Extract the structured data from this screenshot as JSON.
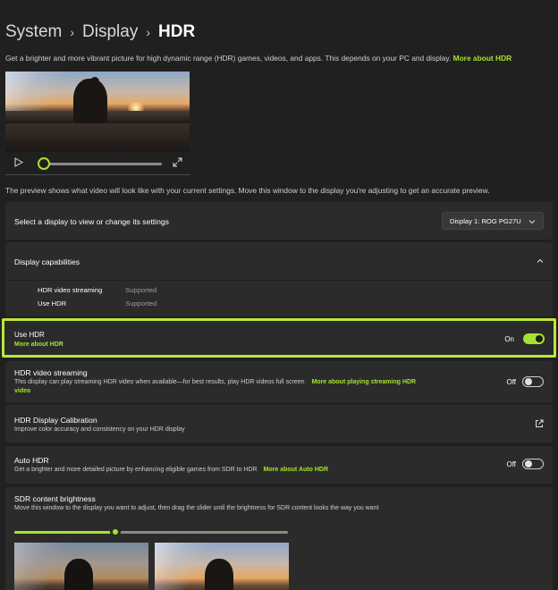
{
  "breadcrumb": {
    "items": [
      "System",
      "Display",
      "HDR"
    ],
    "separator": "›"
  },
  "intro": {
    "text": "Get a brighter and more vibrant picture for high dynamic range (HDR) games, videos, and apps. This depends on your PC and display.",
    "link": "More about HDR"
  },
  "video_preview": {
    "progress": 0.0
  },
  "preview_note": "The preview shows what video will look like with your current settings. Move this window to the display you're adjusting to get an accurate preview.",
  "display_select": {
    "label": "Select a display to view or change its settings",
    "value": "Display 1: ROG PG27U"
  },
  "capabilities": {
    "title": "Display capabilities",
    "rows": [
      {
        "name": "HDR video streaming",
        "value": "Supported"
      },
      {
        "name": "Use HDR",
        "value": "Supported"
      }
    ]
  },
  "use_hdr": {
    "title": "Use HDR",
    "link": "More about HDR",
    "state_label": "On",
    "on": true
  },
  "hdr_streaming": {
    "title": "HDR video streaming",
    "desc": "This display can play streaming HDR video when available—for best results, play HDR videos full screen",
    "link_line1": "More about playing streaming HDR",
    "link_line2": "video",
    "state_label": "Off",
    "on": false
  },
  "calibration": {
    "title": "HDR Display Calibration",
    "desc": "Improve color accuracy and consistency on your HDR display"
  },
  "auto_hdr": {
    "title": "Auto HDR",
    "desc": "Get a brighter and more detailed picture by enhancing eligible games from SDR to HDR",
    "link": "More about Auto HDR",
    "state_label": "Off",
    "on": false
  },
  "sdr_brightness": {
    "title": "SDR content brightness",
    "desc": "Move this window to the display you want to adjust, then drag the slider until the brightness for SDR content looks the way you want",
    "level": 0.37
  },
  "colors": {
    "accent": "#a6e22e",
    "highlight": "#b9e83a",
    "background": "#202020",
    "card": "#2b2b2b"
  },
  "icons": {
    "play": "play-icon",
    "expand": "expand-icon",
    "chevron_down": "chevron-down-icon",
    "chevron_up": "chevron-up-icon",
    "open_external": "open-external-icon"
  }
}
